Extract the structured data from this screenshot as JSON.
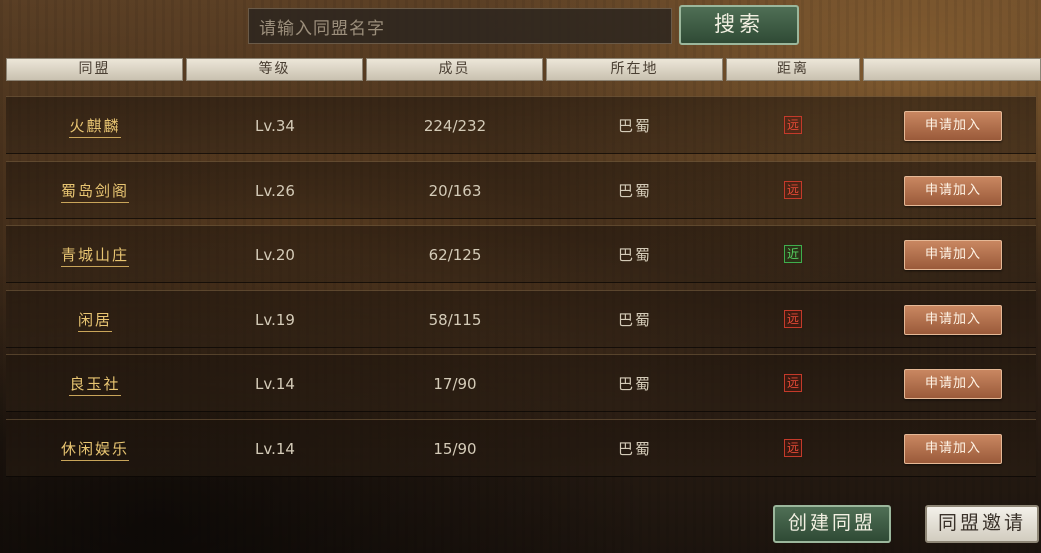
{
  "search": {
    "placeholder": "请输入同盟名字",
    "button_label": "搜索"
  },
  "columns": [
    "同盟",
    "等级",
    "成员",
    "所在地",
    "距离",
    ""
  ],
  "alliances": [
    {
      "name": "火麒麟",
      "level": "Lv.34",
      "members": "224/232",
      "location": "巴蜀",
      "distance": "远",
      "distance_type": "far",
      "action": "申请加入"
    },
    {
      "name": "蜀岛剑阁",
      "level": "Lv.26",
      "members": "20/163",
      "location": "巴蜀",
      "distance": "远",
      "distance_type": "far",
      "action": "申请加入"
    },
    {
      "name": "青城山庄",
      "level": "Lv.20",
      "members": "62/125",
      "location": "巴蜀",
      "distance": "近",
      "distance_type": "near",
      "action": "申请加入"
    },
    {
      "name": "闲居",
      "level": "Lv.19",
      "members": "58/115",
      "location": "巴蜀",
      "distance": "远",
      "distance_type": "far",
      "action": "申请加入"
    },
    {
      "name": "良玉社",
      "level": "Lv.14",
      "members": "17/90",
      "location": "巴蜀",
      "distance": "远",
      "distance_type": "far",
      "action": "申请加入"
    },
    {
      "name": "休闲娱乐",
      "level": "Lv.14",
      "members": "15/90",
      "location": "巴蜀",
      "distance": "远",
      "distance_type": "far",
      "action": "申请加入"
    }
  ],
  "footer": {
    "create_label": "创建同盟",
    "invite_label": "同盟邀请"
  },
  "colors": {
    "far": "#e44a36",
    "near": "#56d060",
    "name_gold": "#e8c572",
    "green_button": "#3f5f45"
  }
}
